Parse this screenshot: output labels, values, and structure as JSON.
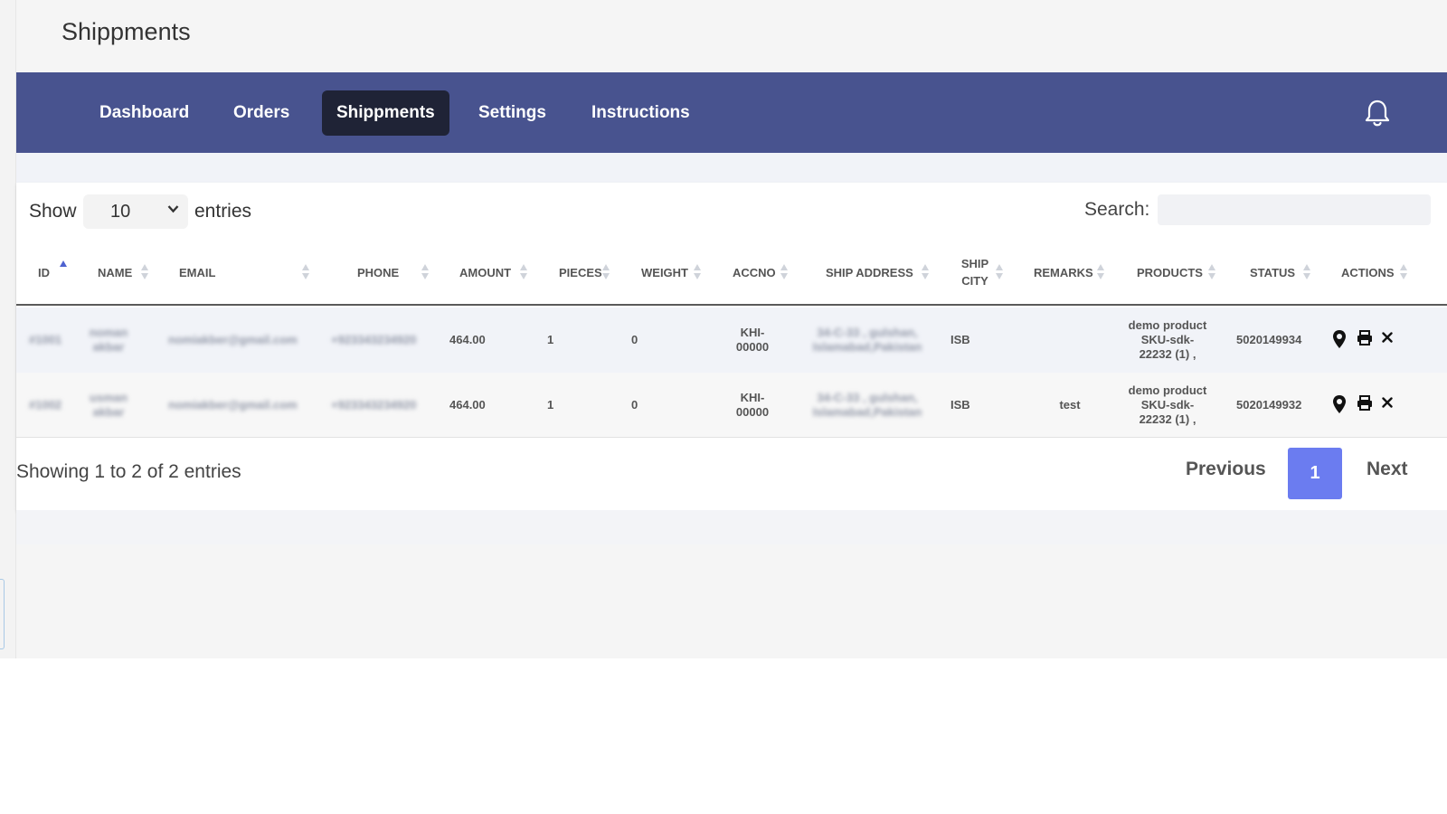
{
  "page": {
    "title": "Shippments"
  },
  "nav": {
    "items": [
      {
        "label": "Dashboard"
      },
      {
        "label": "Orders"
      },
      {
        "label": "Shippments",
        "active": true
      },
      {
        "label": "Settings"
      },
      {
        "label": "Instructions"
      }
    ],
    "bell_icon": "bell-icon"
  },
  "controls": {
    "show_label": "Show",
    "page_size": "10",
    "entries_label": "entries",
    "search_label": "Search:",
    "search_value": ""
  },
  "table": {
    "headers": {
      "id": "ID",
      "name": "NAME",
      "email": "EMAIL",
      "phone": "PHONE",
      "amount": "AMOUNT",
      "pieces": "PIECES",
      "weight": "WEIGHT",
      "accno": "ACCNO",
      "ship_address": "SHIP ADDRESS",
      "ship_city_1": "SHIP",
      "ship_city_2": "CITY",
      "remarks": "REMARKS",
      "products": "PRODUCTS",
      "status": "STATUS",
      "actions": "ACTIONS"
    },
    "sorted_column": "ID",
    "rows": [
      {
        "id": "#1001",
        "name_1": "noman",
        "name_2": "akbar",
        "email": "nomiakber@gmail.com",
        "phone": "+923343234920",
        "amount": "464.00",
        "pieces": "1",
        "weight": "0",
        "accno_1": "KHI-",
        "accno_2": "00000",
        "address_1": "34-C-33 , gulshan,",
        "address_2": "Islamabad,Pakistan",
        "city": "ISB",
        "remarks": "",
        "products_1": "demo product",
        "products_2": "SKU-sdk-",
        "products_3": "22232 (1) ,",
        "status": "5020149934"
      },
      {
        "id": "#1002",
        "name_1": "usman",
        "name_2": "akbar",
        "email": "nomiakber@gmail.com",
        "phone": "+923343234920",
        "amount": "464.00",
        "pieces": "1",
        "weight": "0",
        "accno_1": "KHI-",
        "accno_2": "00000",
        "address_1": "34-C-33 , gulshan,",
        "address_2": "Islamabad,Pakistan",
        "city": "ISB",
        "remarks": "test",
        "products_1": "demo product",
        "products_2": "SKU-sdk-",
        "products_3": "22232 (1) ,",
        "status": "5020149932"
      }
    ],
    "action_icons": [
      "map-pin-icon",
      "printer-icon",
      "close-icon"
    ]
  },
  "footer": {
    "info": "Showing 1 to 2 of 2 entries",
    "previous": "Previous",
    "current_page": "1",
    "next": "Next"
  },
  "colors": {
    "navbar": "#48538f",
    "nav_active": "#1f2336",
    "page_button": "#6b7cf0",
    "sort_active": "#4e62d0"
  }
}
